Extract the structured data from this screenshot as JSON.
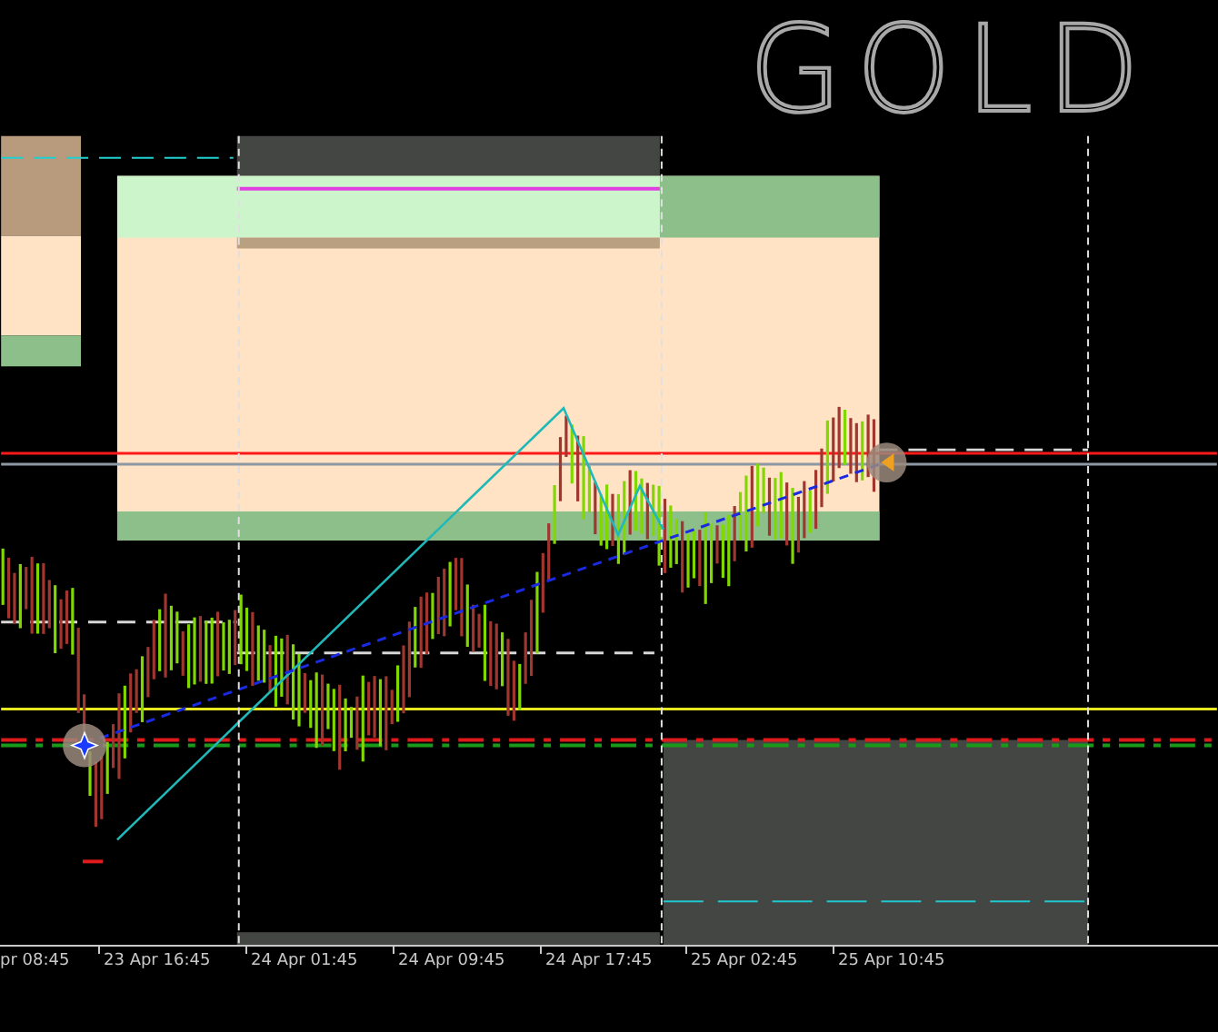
{
  "title_mark": "GOLD",
  "time_axis": {
    "labels": [
      "pr 08:45",
      "23 Apr 16:45",
      "24 Apr 01:45",
      "24 Apr 09:45",
      "24 Apr 17:45",
      "25 Apr 02:45",
      "25 Apr 10:45"
    ]
  }
}
